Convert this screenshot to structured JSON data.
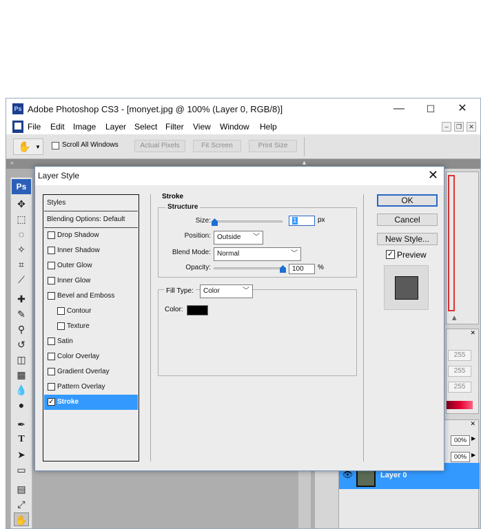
{
  "window": {
    "title": "Adobe Photoshop CS3 - [monyet.jpg @ 100% (Layer 0, RGB/8)]",
    "app_badge": "Ps",
    "minimize": "—",
    "maximize": "☐",
    "close": "✕"
  },
  "menu": [
    "File",
    "Edit",
    "Image",
    "Layer",
    "Select",
    "Filter",
    "View",
    "Window",
    "Help"
  ],
  "doc_controls": {
    "minimize": "–",
    "restore": "❐",
    "close": "✕"
  },
  "options_bar": {
    "scroll_all_windows": "Scroll All Windows",
    "actual_pixels": "Actual Pixels",
    "fit_screen": "Fit Screen",
    "print_size": "Print Size"
  },
  "toolbox": {
    "badge": "Ps"
  },
  "right_panel": {
    "color_values": [
      "255",
      "255",
      "255"
    ],
    "opacity_a": "00%",
    "opacity_b": "00%",
    "layer_name": "Layer 0"
  },
  "dialog": {
    "title": "Layer Style",
    "close": "✕",
    "styles_header": "Styles",
    "blending_options": "Blending Options: Default",
    "styles": [
      {
        "label": "Drop Shadow",
        "checked": false,
        "indent": false
      },
      {
        "label": "Inner Shadow",
        "checked": false,
        "indent": false
      },
      {
        "label": "Outer Glow",
        "checked": false,
        "indent": false
      },
      {
        "label": "Inner Glow",
        "checked": false,
        "indent": false
      },
      {
        "label": "Bevel and Emboss",
        "checked": false,
        "indent": false
      },
      {
        "label": "Contour",
        "checked": false,
        "indent": true
      },
      {
        "label": "Texture",
        "checked": false,
        "indent": true
      },
      {
        "label": "Satin",
        "checked": false,
        "indent": false
      },
      {
        "label": "Color Overlay",
        "checked": false,
        "indent": false
      },
      {
        "label": "Gradient Overlay",
        "checked": false,
        "indent": false
      },
      {
        "label": "Pattern Overlay",
        "checked": false,
        "indent": false
      },
      {
        "label": "Stroke",
        "checked": true,
        "indent": false,
        "selected": true
      }
    ],
    "stroke": {
      "section": "Stroke",
      "structure": "Structure",
      "size_label": "Size:",
      "size_value": "1",
      "size_unit": "px",
      "size_level_pct": 1,
      "position_label": "Position:",
      "position_value": "Outside",
      "blend_label": "Blend Mode:",
      "blend_value": "Normal",
      "opacity_label": "Opacity:",
      "opacity_value": "100",
      "opacity_unit": "%",
      "opacity_level_pct": 100,
      "fill_type_label": "Fill Type:",
      "fill_type_value": "Color",
      "color_label": "Color:",
      "color_value": "#000000"
    },
    "buttons": {
      "ok": "OK",
      "cancel": "Cancel",
      "new_style": "New Style...",
      "preview": "Preview"
    },
    "preview_checked": true
  },
  "colors": {
    "accent": "#3399ff",
    "ps_blue": "#1c3e8e",
    "selection": "#3399ff"
  }
}
